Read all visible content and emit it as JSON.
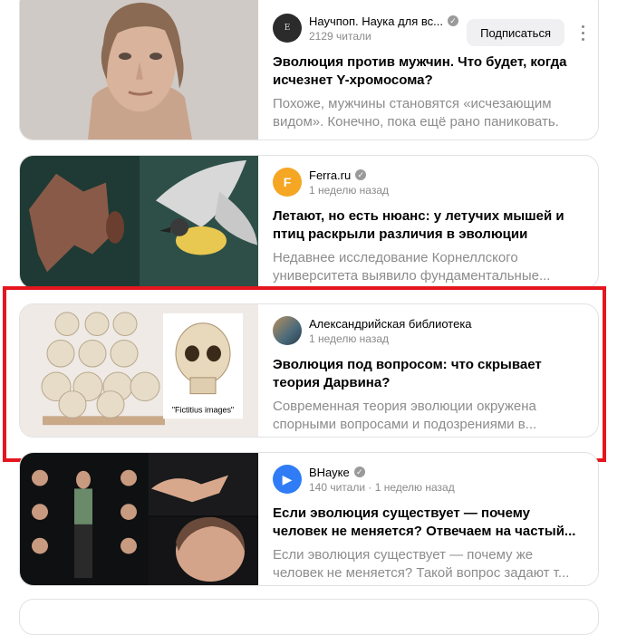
{
  "feed": {
    "cards": [
      {
        "source_name": "Научпоп. Наука для вс...",
        "meta": "2129 читали",
        "subscribe_label": "Подписаться",
        "title": "Эволюция против мужчин. Что будет, когда исчезнет Y-хромосома?",
        "snippet": "Похоже, мужчины становятся «исчезающим видом». Конечно, пока ещё рано паниковать."
      },
      {
        "source_name": "Ferra.ru",
        "meta": "1 неделю назад",
        "title": "Летают, но есть нюанс: у летучих мышей и птиц раскрыли различия в эволюции",
        "snippet": "Недавнее исследование Корнеллского университета выявило фундаментальные..."
      },
      {
        "source_name": "Александрийская библиотека",
        "meta": "1 неделю назад",
        "title": "Эволюция под вопросом: что скрывает теория Дарвина?",
        "snippet": "Современная теория эволюции окружена спорными вопросами и подозрениями в...",
        "image_caption": "\"Fictitius images\""
      },
      {
        "source_name": "ВНауке",
        "meta": "140 читали · 1 неделю назад",
        "title": "Если эволюция существует — почему человек не меняется? Отвечаем на частый...",
        "snippet": "Если эволюция существует — почему же человек не меняется? Такой вопрос задают т..."
      }
    ]
  },
  "colors": {
    "highlight_frame": "#e4161e",
    "ferra_brand": "#f5a623",
    "vnauke_brand": "#2f7cf6",
    "verified_badge": "#9a9a9a"
  },
  "icons": {
    "verified": "check-circle",
    "more": "kebab-vertical"
  }
}
